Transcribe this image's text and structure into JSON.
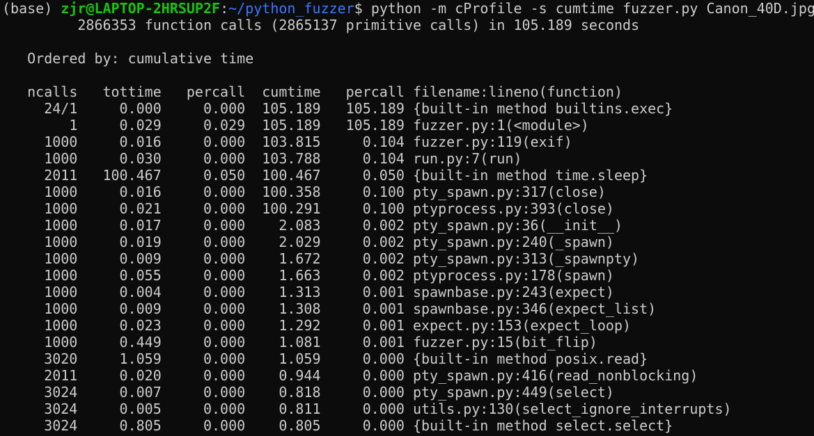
{
  "prompt": {
    "env": "(base) ",
    "user_host": "zjr@LAPTOP-2HRSUP2F",
    "colon": ":",
    "path": "~/python_fuzzer",
    "dollar": "$",
    "command": " python -m cProfile -s cumtime fuzzer.py Canon_40D.jpg"
  },
  "summary": "         2866353 function calls (2865137 primitive calls) in 105.189 seconds",
  "ordered_by": "   Ordered by: cumulative time",
  "table": {
    "headers": {
      "ncalls": "ncalls",
      "tottime": "tottime",
      "percall1": "percall",
      "cumtime": "cumtime",
      "percall2": "percall",
      "func": "filename:lineno(function)"
    },
    "rows": [
      {
        "ncalls": "24/1",
        "tottime": "0.000",
        "percall1": "0.000",
        "cumtime": "105.189",
        "percall2": "105.189",
        "func": "{built-in method builtins.exec}"
      },
      {
        "ncalls": "1",
        "tottime": "0.029",
        "percall1": "0.029",
        "cumtime": "105.189",
        "percall2": "105.189",
        "func": "fuzzer.py:1(<module>)"
      },
      {
        "ncalls": "1000",
        "tottime": "0.016",
        "percall1": "0.000",
        "cumtime": "103.815",
        "percall2": "0.104",
        "func": "fuzzer.py:119(exif)"
      },
      {
        "ncalls": "1000",
        "tottime": "0.030",
        "percall1": "0.000",
        "cumtime": "103.788",
        "percall2": "0.104",
        "func": "run.py:7(run)"
      },
      {
        "ncalls": "2011",
        "tottime": "100.467",
        "percall1": "0.050",
        "cumtime": "100.467",
        "percall2": "0.050",
        "func": "{built-in method time.sleep}"
      },
      {
        "ncalls": "1000",
        "tottime": "0.016",
        "percall1": "0.000",
        "cumtime": "100.358",
        "percall2": "0.100",
        "func": "pty_spawn.py:317(close)"
      },
      {
        "ncalls": "1000",
        "tottime": "0.021",
        "percall1": "0.000",
        "cumtime": "100.291",
        "percall2": "0.100",
        "func": "ptyprocess.py:393(close)"
      },
      {
        "ncalls": "1000",
        "tottime": "0.017",
        "percall1": "0.000",
        "cumtime": "2.083",
        "percall2": "0.002",
        "func": "pty_spawn.py:36(__init__)"
      },
      {
        "ncalls": "1000",
        "tottime": "0.019",
        "percall1": "0.000",
        "cumtime": "2.029",
        "percall2": "0.002",
        "func": "pty_spawn.py:240(_spawn)"
      },
      {
        "ncalls": "1000",
        "tottime": "0.009",
        "percall1": "0.000",
        "cumtime": "1.672",
        "percall2": "0.002",
        "func": "pty_spawn.py:313(_spawnpty)"
      },
      {
        "ncalls": "1000",
        "tottime": "0.055",
        "percall1": "0.000",
        "cumtime": "1.663",
        "percall2": "0.002",
        "func": "ptyprocess.py:178(spawn)"
      },
      {
        "ncalls": "1000",
        "tottime": "0.004",
        "percall1": "0.000",
        "cumtime": "1.313",
        "percall2": "0.001",
        "func": "spawnbase.py:243(expect)"
      },
      {
        "ncalls": "1000",
        "tottime": "0.009",
        "percall1": "0.000",
        "cumtime": "1.308",
        "percall2": "0.001",
        "func": "spawnbase.py:346(expect_list)"
      },
      {
        "ncalls": "1000",
        "tottime": "0.023",
        "percall1": "0.000",
        "cumtime": "1.292",
        "percall2": "0.001",
        "func": "expect.py:153(expect_loop)"
      },
      {
        "ncalls": "1000",
        "tottime": "0.449",
        "percall1": "0.000",
        "cumtime": "1.081",
        "percall2": "0.001",
        "func": "fuzzer.py:15(bit_flip)"
      },
      {
        "ncalls": "3020",
        "tottime": "1.059",
        "percall1": "0.000",
        "cumtime": "1.059",
        "percall2": "0.000",
        "func": "{built-in method posix.read}"
      },
      {
        "ncalls": "2011",
        "tottime": "0.020",
        "percall1": "0.000",
        "cumtime": "0.944",
        "percall2": "0.000",
        "func": "pty_spawn.py:416(read_nonblocking)"
      },
      {
        "ncalls": "3024",
        "tottime": "0.007",
        "percall1": "0.000",
        "cumtime": "0.818",
        "percall2": "0.000",
        "func": "pty_spawn.py:449(select)"
      },
      {
        "ncalls": "3024",
        "tottime": "0.005",
        "percall1": "0.000",
        "cumtime": "0.811",
        "percall2": "0.000",
        "func": "utils.py:130(select_ignore_interrupts)"
      },
      {
        "ncalls": "3024",
        "tottime": "0.805",
        "percall1": "0.000",
        "cumtime": "0.805",
        "percall2": "0.000",
        "func": "{built-in method select.select}"
      }
    ]
  },
  "colors": {
    "background": "#0c0c0c",
    "text": "#cccccc",
    "user_host": "#16c60c",
    "path": "#3b78ff"
  }
}
